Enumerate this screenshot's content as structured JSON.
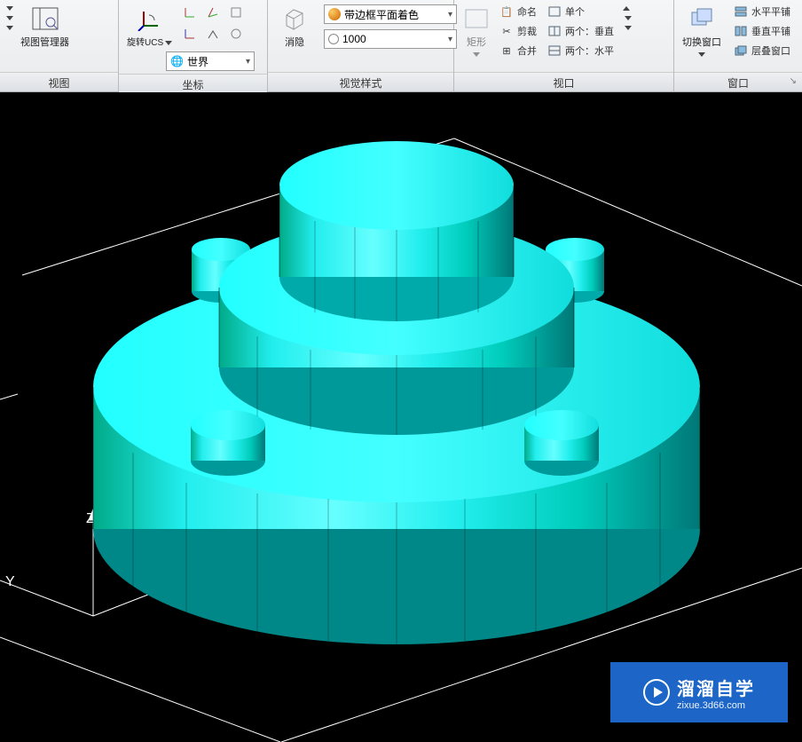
{
  "ribbon": {
    "view": {
      "title": "视图",
      "manager_label": "视图管理器"
    },
    "coords": {
      "title": "坐标",
      "rotate_label": "旋转UCS",
      "world_label": "世界"
    },
    "visual": {
      "title": "视觉样式",
      "hide_label": "消隐",
      "style_value": "带边框平面着色",
      "number_value": "1000"
    },
    "viewport": {
      "title": "视口",
      "rect_label": "矩形",
      "name_label": "命名",
      "clip_label": "剪裁",
      "merge_label": "合并",
      "single_label": "单个",
      "two_vertical": "两个：垂直",
      "two_horizontal": "两个：水平"
    },
    "window": {
      "title": "窗口",
      "switch_label": "切换窗口",
      "htile": "水平平铺",
      "vtile": "垂直平铺",
      "cascade": "层叠窗口"
    }
  },
  "axes": {
    "z": "Z",
    "y": "Y"
  },
  "watermark": {
    "name": "溜溜自学",
    "url": "zixue.3d66.com"
  }
}
